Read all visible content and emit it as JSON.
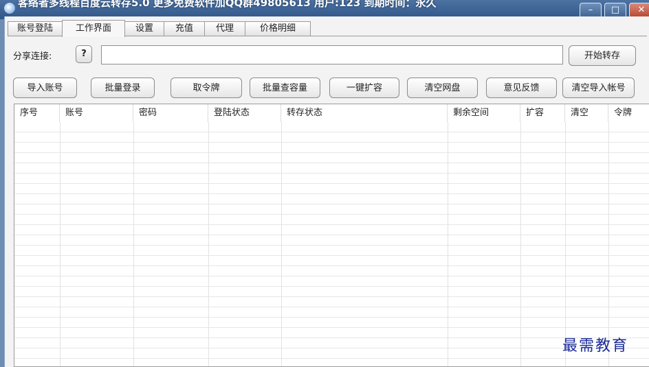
{
  "window": {
    "title": "客络者多线程百度云转存5.0 更多免费软件加QQ群49805613 用户:123 到期时间：永久",
    "controls": {
      "minimize": "–",
      "maximize": "□",
      "close": "✕"
    }
  },
  "tabs": [
    "账号登陆",
    "工作界面",
    "设置",
    "充值",
    "代理",
    "价格明细"
  ],
  "active_tab": "工作界面",
  "share": {
    "label": "分享连接:",
    "help": "?",
    "value": "",
    "start_button": "开始转存"
  },
  "toolbar": [
    "导入账号",
    "批量登录",
    "取令牌",
    "批量查容量",
    "一键扩容",
    "清空网盘",
    "意见反馈",
    "清空导入帐号"
  ],
  "table": {
    "columns": [
      "序号",
      "账号",
      "密码",
      "登陆状态",
      "转存状态",
      "剩余空间",
      "扩容",
      "清空",
      "令牌"
    ],
    "rows": []
  },
  "watermark": "最需教育"
}
